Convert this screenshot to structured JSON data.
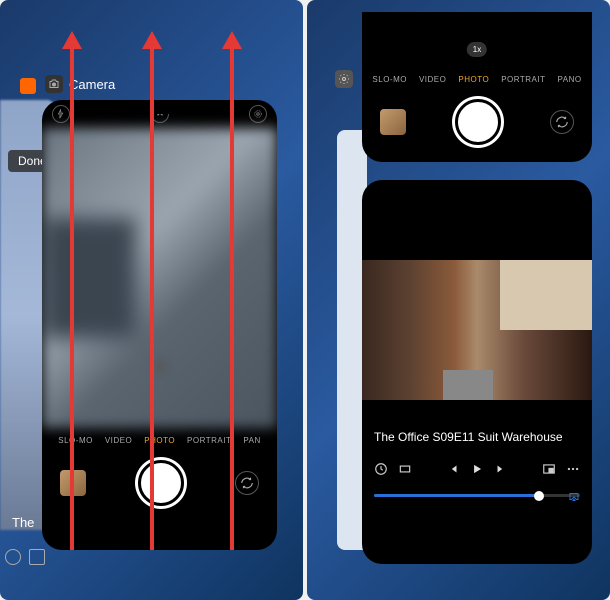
{
  "left": {
    "done_label": "Done",
    "app_name": "Camera",
    "video_title_truncated": "The",
    "camera": {
      "modes": [
        "SLO-MO",
        "VIDEO",
        "PHOTO",
        "PORTRAIT",
        "PAN"
      ],
      "active_mode": "PHOTO"
    }
  },
  "right": {
    "camera_up": {
      "zoom_label": "1x",
      "modes": [
        "SLO-MO",
        "VIDEO",
        "PHOTO",
        "PORTRAIT",
        "PANO"
      ],
      "active_mode": "PHOTO"
    },
    "video": {
      "title": "The Office S09E11 Suit Warehouse",
      "progress_percent": 80
    }
  },
  "icons": {
    "camera_app": "camera-icon",
    "flash": "flash-off-icon",
    "chevron": "chevron-up-icon",
    "live": "live-photo-icon",
    "flip": "camera-flip-icon",
    "settings": "gear-icon",
    "clock": "clock-icon",
    "aspect": "aspect-icon",
    "prev": "previous-icon",
    "play": "play-icon",
    "next": "next-icon",
    "pip": "pip-icon",
    "more": "more-icon",
    "airplay": "airplay-icon"
  }
}
